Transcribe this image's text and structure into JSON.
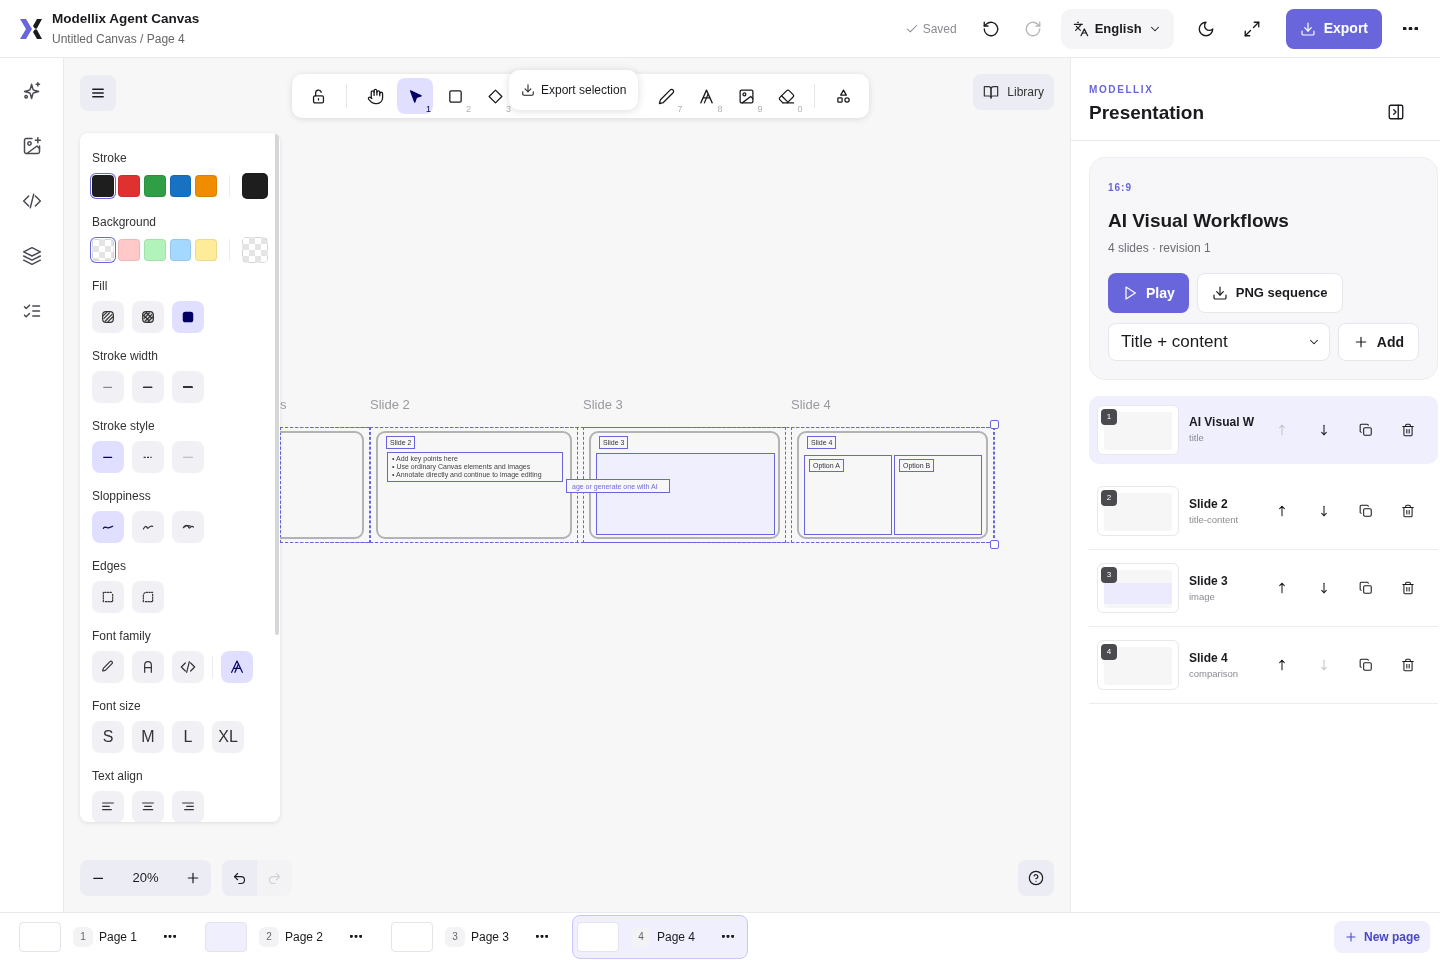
{
  "header": {
    "app_title": "Modellix Agent Canvas",
    "breadcrumb": "Untitled Canvas / Page 4",
    "save_status": "Saved",
    "redo_disabled": true,
    "language": "English",
    "export_label": "Export"
  },
  "rail": [
    {
      "kind": "sparkles"
    },
    {
      "kind": "image-plus"
    },
    {
      "kind": "code"
    },
    {
      "kind": "layers"
    },
    {
      "kind": "list"
    }
  ],
  "toolbar": {
    "tools": [
      {
        "kind": "lock",
        "selected": false
      },
      {
        "kind": "hand",
        "selected": false
      },
      {
        "kind": "select",
        "key": "1",
        "selected": true
      },
      {
        "kind": "rectangle",
        "key": "2",
        "selected": false
      },
      {
        "kind": "diamond",
        "key": "3",
        "selected": false
      },
      {
        "kind": "pencil",
        "key": "7",
        "selected": false
      },
      {
        "kind": "text",
        "key": "8",
        "selected": false
      },
      {
        "kind": "image",
        "key": "9",
        "selected": false
      },
      {
        "kind": "eraser",
        "key": "0",
        "selected": false
      },
      {
        "kind": "shapes",
        "selected": false
      }
    ],
    "popover": "Export selection"
  },
  "library": "Library",
  "properties": [
    {
      "label": "Stroke",
      "kind": "swatches",
      "swatches": [
        {
          "color": "#1e1e1e",
          "selected": true
        },
        {
          "color": "#e03131",
          "selected": false
        },
        {
          "color": "#2f9e44",
          "selected": false
        },
        {
          "color": "#1971c2",
          "selected": false
        },
        {
          "color": "#f08c00",
          "selected": false
        }
      ],
      "current": {
        "color": "#1e1e1e"
      }
    },
    {
      "label": "Background",
      "kind": "swatches",
      "swatches": [
        {
          "kind": "transparent",
          "selected": true
        },
        {
          "color": "#ffc9c9",
          "selected": false
        },
        {
          "color": "#b2f2bb",
          "selected": false
        },
        {
          "color": "#a5d8ff",
          "selected": false
        },
        {
          "color": "#ffec99",
          "selected": false
        }
      ],
      "current": {
        "kind": "transparent"
      }
    },
    {
      "label": "Fill",
      "kind": "options",
      "options": [
        {
          "kind": "hachure",
          "selected": false
        },
        {
          "kind": "cross-hatch",
          "selected": false
        },
        {
          "kind": "solid",
          "selected": true
        }
      ]
    },
    {
      "label": "Stroke width",
      "kind": "options",
      "options": [
        {
          "kind": "thin",
          "selected": false
        },
        {
          "kind": "bold",
          "selected": false
        },
        {
          "kind": "extra-bold",
          "selected": false
        }
      ]
    },
    {
      "label": "Stroke style",
      "kind": "options",
      "options": [
        {
          "kind": "solid-line",
          "selected": true
        },
        {
          "kind": "dashed",
          "selected": false
        },
        {
          "kind": "dotted",
          "selected": false
        }
      ]
    },
    {
      "label": "Sloppiness",
      "kind": "options",
      "options": [
        {
          "kind": "architect",
          "selected": true
        },
        {
          "kind": "artist",
          "selected": false
        },
        {
          "kind": "cartoonist",
          "selected": false
        }
      ]
    },
    {
      "label": "Edges",
      "kind": "options",
      "options": [
        {
          "kind": "sharp",
          "selected": false
        },
        {
          "kind": "round",
          "selected": false
        }
      ]
    },
    {
      "label": "Font family",
      "kind": "options",
      "options": [
        {
          "kind": "hand-drawn",
          "selected": false
        },
        {
          "kind": "normal",
          "selected": false
        },
        {
          "kind": "code",
          "selected": false
        },
        {
          "kind": "separator"
        },
        {
          "kind": "serif",
          "selected": true
        }
      ]
    },
    {
      "label": "Font size",
      "kind": "options",
      "options": [
        {
          "label": "S",
          "selected": false
        },
        {
          "label": "M",
          "selected": false
        },
        {
          "label": "L",
          "selected": false
        },
        {
          "label": "XL",
          "selected": false
        }
      ]
    },
    {
      "label": "Text align",
      "kind": "options",
      "options": [
        {
          "kind": "align-left",
          "selected": false
        },
        {
          "kind": "align-center",
          "selected": false
        },
        {
          "kind": "align-right",
          "selected": false
        }
      ]
    }
  ],
  "frames": [
    {
      "label": "s",
      "kind": "partial"
    },
    {
      "label": "Slide 2",
      "kind": "title-content",
      "heading": "Slide 2",
      "bullets": [
        "• Add key points here",
        "• Use ordinary Canvas elements and images",
        "• Annotate directly and continue to image editing"
      ]
    },
    {
      "label": "Slide 3",
      "kind": "image",
      "heading": "Slide 3",
      "caption": "age or generate one with AI"
    },
    {
      "label": "Slide 4",
      "kind": "comparison",
      "heading": "Slide 4",
      "options": [
        "Option A",
        "Option B"
      ]
    }
  ],
  "zoom": {
    "level_text": "20%",
    "undo_disabled": false,
    "redo_disabled": true
  },
  "panel": {
    "brand": "MODELLIX",
    "title": "Presentation",
    "deck": {
      "ratio": "16:9",
      "title": "AI Visual Workflows",
      "meta": "4 slides · revision 1",
      "play": "Play",
      "png": "PNG sequence",
      "layout": "Title + content",
      "add": "Add"
    },
    "slides": [
      {
        "number": "1",
        "title": "AI Visual W",
        "type": "title",
        "selected": true,
        "up_disabled": true,
        "down_disabled": false
      },
      {
        "number": "2",
        "title": "Slide 2",
        "type": "title-content",
        "selected": false,
        "up_disabled": false,
        "down_disabled": false
      },
      {
        "number": "3",
        "title": "Slide 3",
        "type": "image",
        "selected": false,
        "up_disabled": false,
        "down_disabled": false
      },
      {
        "number": "4",
        "title": "Slide 4",
        "type": "comparison",
        "selected": false,
        "up_disabled": false,
        "down_disabled": true
      }
    ]
  },
  "pages": [
    {
      "number": "1",
      "label": "Page 1",
      "selected": false
    },
    {
      "number": "2",
      "label": "Page 2",
      "selected": false
    },
    {
      "number": "3",
      "label": "Page 3",
      "selected": false
    },
    {
      "number": "4",
      "label": "Page 4",
      "selected": true
    }
  ],
  "new_page": "New page"
}
